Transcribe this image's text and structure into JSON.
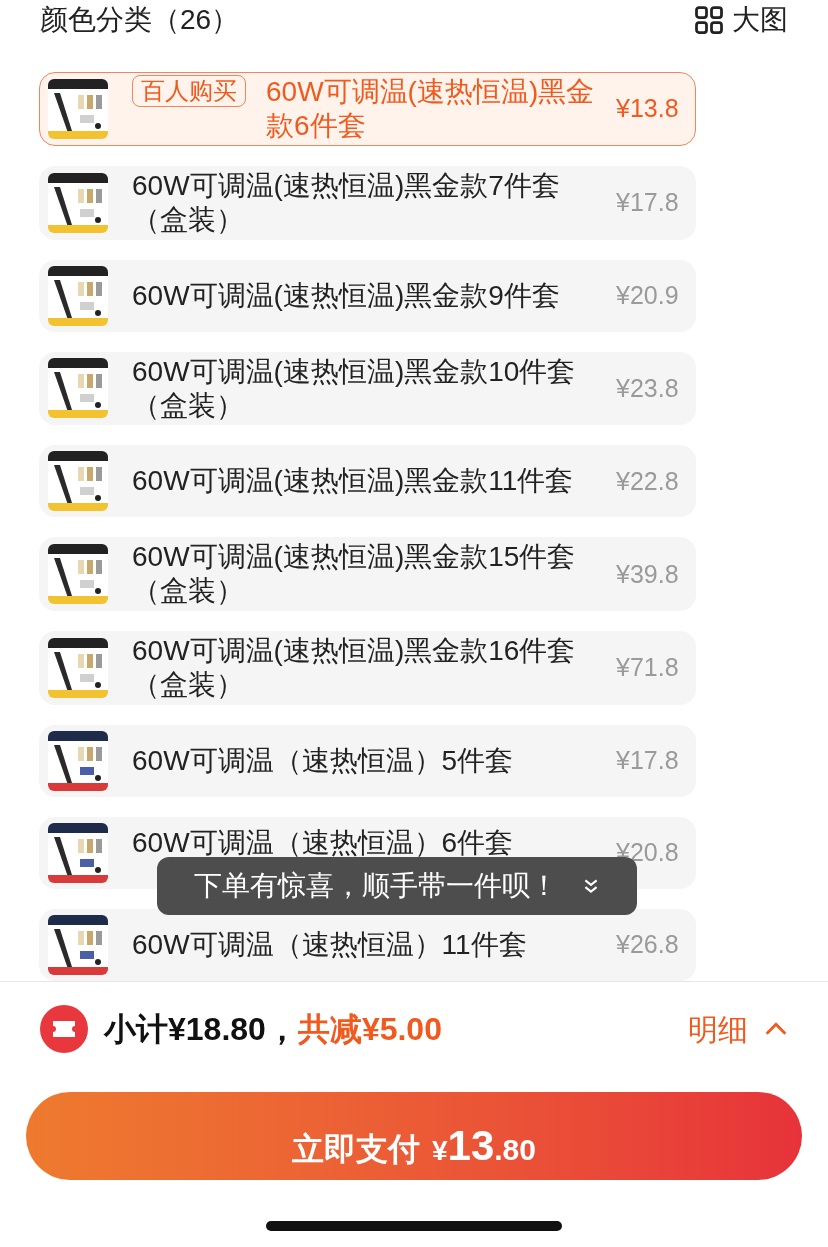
{
  "header": {
    "title": "颜色分类（26）",
    "view_toggle": "大图"
  },
  "options": [
    {
      "badge": "百人购买",
      "name": "60W可调温(速热恒温)黑金款6件套",
      "price": "¥13.8",
      "selected": true,
      "kind": "picture"
    },
    {
      "name": "60W可调温(速热恒温)黑金款7件套（盒装）",
      "price": "¥17.8",
      "selected": false,
      "kind": "picture"
    },
    {
      "name": "60W可调温(速热恒温)黑金款9件套",
      "price": "¥20.9",
      "selected": false,
      "kind": "picture"
    },
    {
      "name": "60W可调温(速热恒温)黑金款10件套（盒装）",
      "price": "¥23.8",
      "selected": false,
      "kind": "picture"
    },
    {
      "name": "60W可调温(速热恒温)黑金款11件套",
      "price": "¥22.8",
      "selected": false,
      "kind": "picture"
    },
    {
      "name": "60W可调温(速热恒温)黑金款15件套（盒装）",
      "price": "¥39.8",
      "selected": false,
      "kind": "picture"
    },
    {
      "name": "60W可调温(速热恒温)黑金款16件套（盒装）",
      "price": "¥71.8",
      "selected": false,
      "kind": "picture"
    },
    {
      "name": "60W可调温（速热恒温）5件套",
      "price": "¥17.8",
      "selected": false,
      "kind": "picture"
    },
    {
      "name": "60W可调温（速热恒温）6件套",
      "price": "¥20.8",
      "selected": false,
      "kind": "picture"
    },
    {
      "name": "60W可调温（速热恒温）11件套",
      "price": "¥26.8",
      "selected": false,
      "kind": "picture"
    }
  ],
  "toast": {
    "text": "下单有惊喜，顺手带一件呗！"
  },
  "footer": {
    "subtotal": "小计¥18.80，",
    "discount": "共减¥5.00",
    "details": "明细",
    "details_expanded": false
  },
  "pay_button": {
    "label": "立即支付",
    "currency": "¥",
    "amount_int": "13",
    "amount_dec": ".80"
  }
}
